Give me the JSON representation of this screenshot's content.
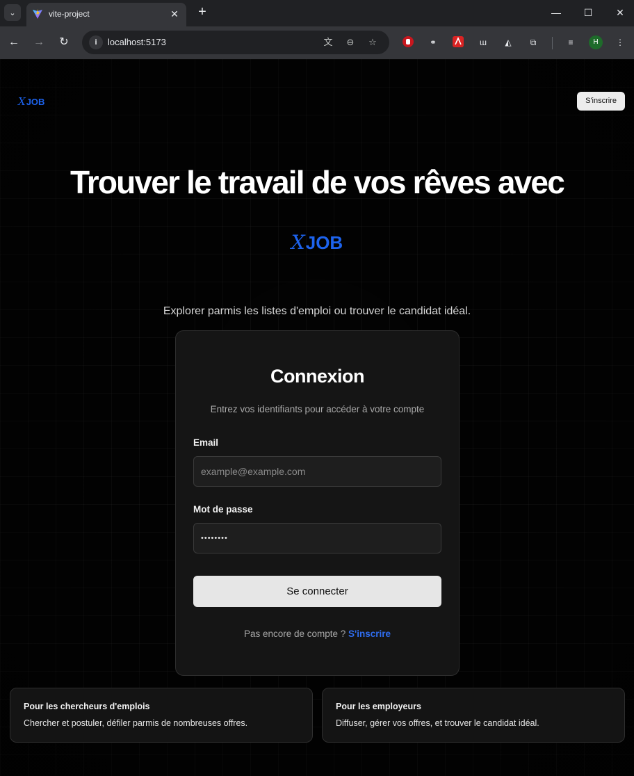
{
  "browser": {
    "tab_title": "vite-project",
    "url": "localhost:5173",
    "avatar_letter": "H",
    "icons": {
      "tab_search": "chevron-down-icon",
      "close_tab": "close-icon",
      "new_tab": "plus-icon",
      "minimize": "minimize-icon",
      "maximize": "maximize-icon",
      "close_window": "close-icon",
      "back": "arrow-left-icon",
      "forward": "arrow-right-icon",
      "reload": "reload-icon",
      "site_info": "info-icon",
      "translate": "translate-icon",
      "zoom": "zoom-out-icon",
      "bookmark": "star-icon",
      "extensions": [
        "ublock-icon",
        "cloud-link-icon",
        "pdf-icon",
        "dictionary-icon",
        "proton-icon",
        "puzzle-icon",
        "media-queue-icon"
      ],
      "menu": "kebab-menu-icon"
    }
  },
  "header": {
    "logo_mark": "X",
    "logo_text": "JOB",
    "signup_label": "S'inscrire"
  },
  "hero": {
    "title": "Trouver le travail de vos rêves avec",
    "logo_mark": "X",
    "logo_text": "JOB",
    "subtitle": "Explorer parmis les listes d'emploi ou trouver le candidat idéal."
  },
  "login": {
    "title": "Connexion",
    "description": "Entrez vos identifiants pour accéder à votre compte",
    "email_label": "Email",
    "email_placeholder": "example@example.com",
    "email_value": "",
    "password_label": "Mot de passe",
    "password_value": "••••••••",
    "submit_label": "Se connecter",
    "footer_text": "Pas encore de compte ? ",
    "footer_link": "S'inscrire"
  },
  "features": [
    {
      "title": "Pour les chercheurs d'emplois",
      "description": "Chercher et postuler, défiler parmis de nombreuses offres."
    },
    {
      "title": "Pour les employeurs",
      "description": "Diffuser, gérer vos offres, et trouver le candidat idéal."
    }
  ],
  "colors": {
    "accent": "#1d63ed",
    "link": "#2f6df0",
    "page_background": "#030303",
    "card_background": "#151515"
  }
}
